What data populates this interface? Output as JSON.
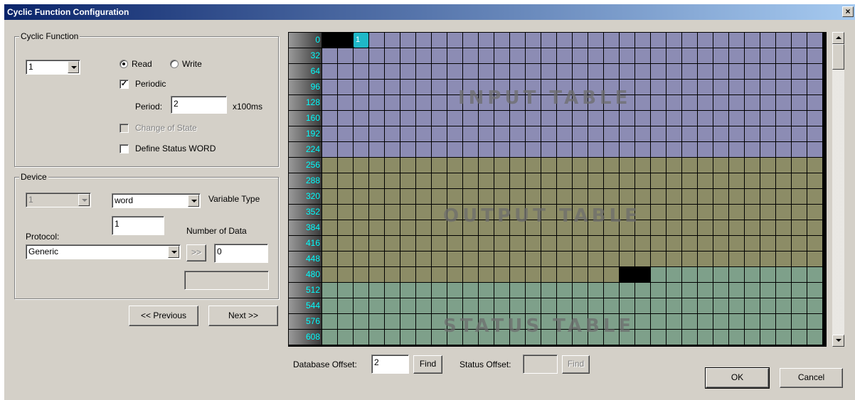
{
  "window": {
    "title": "Cyclic Function Configuration",
    "close_glyph": "×"
  },
  "cyclic_function": {
    "group_label": "Cyclic Function",
    "function_number": "1",
    "read_label": "Read",
    "write_label": "Write",
    "mode": "Read",
    "periodic_label": "Periodic",
    "periodic_checked": true,
    "period_label": "Period:",
    "period_value": "2",
    "period_unit": "x100ms",
    "change_of_state_label": "Change of State",
    "change_of_state_checked": false,
    "define_status_label": "Define Status WORD",
    "define_status_checked": false
  },
  "device": {
    "group_label": "Device",
    "device_number": "1",
    "variable_type_value": "word",
    "variable_type_label": "Variable Type",
    "number_of_data_value": "1",
    "number_of_data_label": "Number of Data",
    "protocol_label": "Protocol:",
    "protocol_value": "Generic",
    "transfer_button": ">>",
    "transfer_value": "0",
    "extra_value": ""
  },
  "navigation": {
    "previous_label": "<< Previous",
    "next_label": "Next >>"
  },
  "memory_map": {
    "row_addresses": [
      "0",
      "32",
      "64",
      "96",
      "128",
      "160",
      "192",
      "224",
      "256",
      "288",
      "320",
      "352",
      "384",
      "416",
      "448",
      "480",
      "512",
      "544",
      "576",
      "608"
    ],
    "columns": 32,
    "tables": [
      {
        "name": "INPUT TABLE",
        "start": 0,
        "end": 256,
        "color": "#8c8cb4"
      },
      {
        "name": "OUTPUT TABLE",
        "start": 256,
        "end": 501,
        "color": "#8c8c66"
      },
      {
        "name": "STATUS TABLE",
        "start": 501,
        "end": 640,
        "color": "#7ea08a"
      }
    ],
    "black_cells": [
      0,
      1,
      499,
      500
    ],
    "selected_cell": 2,
    "selected_cell_text": "1",
    "grid_line_color": "#000000",
    "black_cell_color": "#000000",
    "selected_cell_color": "#1fb8c8"
  },
  "bottom": {
    "database_offset_label": "Database Offset:",
    "database_offset_value": "2",
    "find_label": "Find",
    "status_offset_label": "Status Offset:",
    "status_offset_value": "",
    "status_find_label": "Find",
    "ok_label": "OK",
    "cancel_label": "Cancel"
  }
}
